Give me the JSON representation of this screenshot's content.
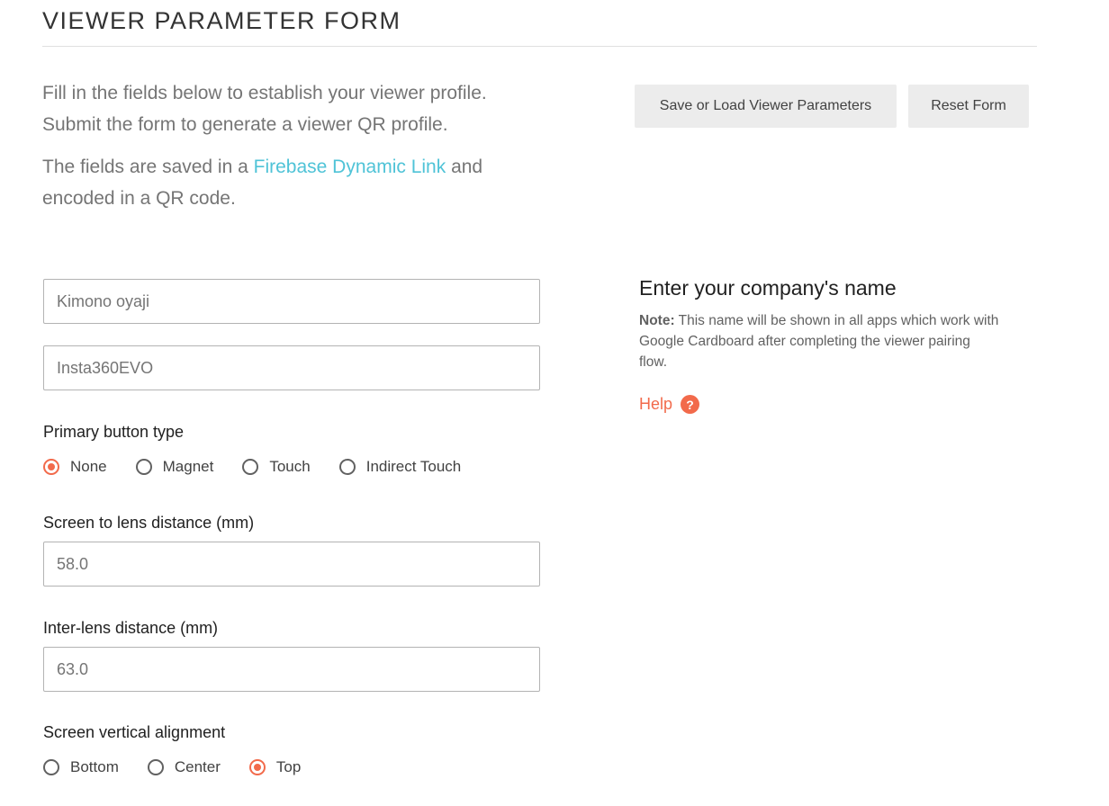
{
  "header": {
    "title": "VIEWER PARAMETER FORM"
  },
  "intro": {
    "line1": "Fill in the fields below to establish your viewer profile.",
    "line2": "Submit the form to generate a viewer QR profile.",
    "saved_prefix": "The fields are saved in a ",
    "link_text": "Firebase Dynamic Link",
    "saved_suffix": " and encoded in a QR code."
  },
  "actions": {
    "save_load_label": "Save or Load Viewer Parameters",
    "reset_label": "Reset Form"
  },
  "form": {
    "company_name": {
      "value": "Kimono oyaji"
    },
    "viewer_name": {
      "value": "Insta360EVO"
    },
    "primary_button": {
      "label": "Primary button type",
      "options": [
        "None",
        "Magnet",
        "Touch",
        "Indirect Touch"
      ],
      "selected": "None"
    },
    "screen_lens_distance": {
      "label": "Screen to lens distance (mm)",
      "value": "58.0"
    },
    "inter_lens_distance": {
      "label": "Inter-lens distance (mm)",
      "value": "63.0"
    },
    "vertical_alignment": {
      "label": "Screen vertical alignment",
      "options": [
        "Bottom",
        "Center",
        "Top"
      ],
      "selected": "Top"
    }
  },
  "info_panel": {
    "title": "Enter your company's name",
    "note_label": "Note:",
    "note_text": " This name will be shown in all apps which work with Google Cardboard after completing the viewer pairing flow.",
    "help_label": "Help",
    "help_icon": "question-circle-icon"
  },
  "colors": {
    "accent": "#f26a4b",
    "link": "#4fc3d7"
  }
}
